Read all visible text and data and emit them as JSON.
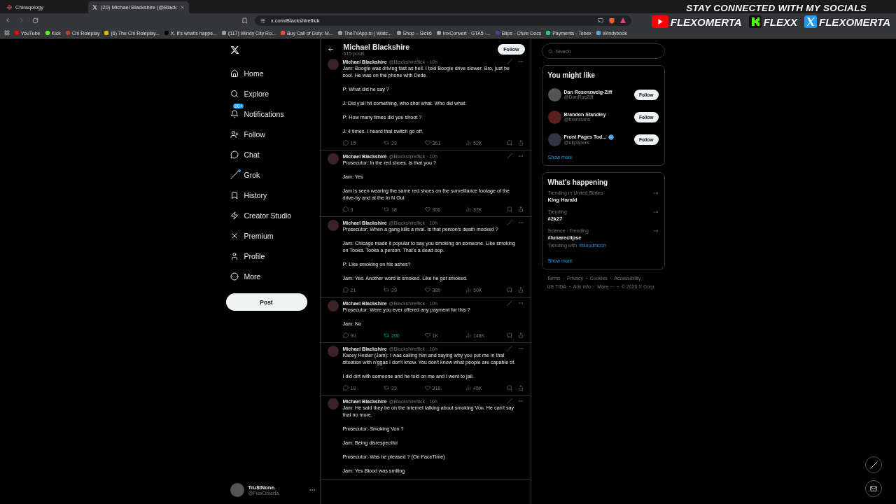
{
  "browser": {
    "tabs": [
      {
        "title": "Chiraqology",
        "selected": false
      },
      {
        "title": "(20) Michael Blackshire (@Black",
        "selected": true
      }
    ],
    "address": "x.com/Blackshireflick",
    "bookmarks": [
      {
        "label": "YouTube",
        "color": "#ff0000"
      },
      {
        "label": "Kick",
        "color": "#53fc18"
      },
      {
        "label": "Chi Roleplay",
        "color": "#c0392b"
      },
      {
        "label": "(6) The Chi Roleplay...",
        "color": "#e6b800"
      },
      {
        "label": "X. It's what's happe...",
        "color": "#000000"
      },
      {
        "label": "(117) Windy City Ro...",
        "color": "#9aa0a6"
      },
      {
        "label": "Buy Call of Duty: M...",
        "color": "#e74c3c"
      },
      {
        "label": "TheTVApp.to | Watc...",
        "color": "#9aa0a6"
      },
      {
        "label": "Shop – Sick6",
        "color": "#9aa0a6"
      },
      {
        "label": "InxConvert - GTA5 -...",
        "color": "#9aa0a6"
      },
      {
        "label": "Blips - Cfure Docs",
        "color": "#3b4a8c"
      },
      {
        "label": "Payments - Tebex",
        "color": "#2ecc71"
      },
      {
        "label": "Windybook",
        "color": "#5dade2"
      }
    ]
  },
  "overlay": {
    "heading": "STAY CONNECTED WITH MY SOCIALS",
    "socials": [
      {
        "kind": "youtube",
        "handle": "FLEXOMERTA"
      },
      {
        "kind": "kick",
        "handle": "FLEXX"
      },
      {
        "kind": "x",
        "handle": "FLEXOMERTA"
      }
    ]
  },
  "nav": {
    "items": [
      {
        "label": "Home",
        "dot": false
      },
      {
        "label": "Explore",
        "dot": false
      },
      {
        "label": "Notifications",
        "badge": "20+",
        "dot": false
      },
      {
        "label": "Follow",
        "dot": false
      },
      {
        "label": "Chat",
        "dot": false
      },
      {
        "label": "Grok",
        "dot": true
      },
      {
        "label": "History",
        "dot": false
      },
      {
        "label": "Creator Studio",
        "dot": false
      },
      {
        "label": "Premium",
        "dot": false
      },
      {
        "label": "Profile",
        "dot": false
      },
      {
        "label": "More",
        "dot": false
      }
    ],
    "post_button": "Post",
    "account": {
      "name": "Tru$tNone.",
      "handle": "@FlexOmerta"
    }
  },
  "profile_header": {
    "name": "Michael Blackshire",
    "posts": "615 posts",
    "follow": "Follow"
  },
  "tweets": [
    {
      "author": "Michael Blackshire",
      "handle": "@Blackshireflick · 10h",
      "paragraphs": [
        "Jam: Boogie was driving fast as hell. I told Boogie drive slower. Bro, just be cool. He was on the phone with Dede.",
        "P: What did he say ?",
        "J: Did y'all hit something, who shot what. Who did what.",
        "P: How many times did you shoot ?",
        "J: 4 times. I heard that switch go off."
      ],
      "replies": "15",
      "reposts": "23",
      "likes": "361",
      "views": "52K",
      "repost_highlighted": false
    },
    {
      "author": "Michael Blackshire",
      "handle": "@Blackshireflick · 10h",
      "paragraphs": [
        "Prosecutor: In the red shoes. Is that you ?",
        "Jam: Yes",
        "Jam is seen wearing the same red shoes on the surveillance footage of the drive-by and at the In N Out"
      ],
      "replies": "3",
      "reposts": "18",
      "likes": "306",
      "views": "37K",
      "repost_highlighted": false
    },
    {
      "author": "Michael Blackshire",
      "handle": "@Blackshireflick · 10h",
      "paragraphs": [
        "Prosecutor: When a gang kills a rival. Is that person's death mocked ?",
        "Jam: Chicago made it popular to say you smoking on someone. Like smoking on Tooka. Tooka a person. That's a dead oop.",
        "P: Like smoking on his ashes?",
        "Jam: Yes. Another word is smoked. Like he got smoked."
      ],
      "replies": "21",
      "reposts": "29",
      "likes": "389",
      "views": "50K",
      "repost_highlighted": false
    },
    {
      "author": "Michael Blackshire",
      "handle": "@Blackshireflick · 10h",
      "paragraphs": [
        "Prosecutor: Were you ever offered any payment for this ?",
        "Jam: No"
      ],
      "replies": "90",
      "reposts": "200",
      "likes": "1K",
      "views": "148K",
      "repost_highlighted": true
    },
    {
      "author": "Michael Blackshire",
      "handle": "@Blackshireflick · 10h",
      "paragraphs": [
        "Kacey Hester (Jam): I was calling him and saying why you put me in that situation with n'ggas I don't know. You don't know what people are capable of.",
        "I did dirt with someone and he told on me and I went to jail."
      ],
      "replies": "18",
      "reposts": "23",
      "likes": "318",
      "views": "45K",
      "repost_highlighted": false
    },
    {
      "author": "Michael Blackshire",
      "handle": "@Blackshireflick · 10h",
      "paragraphs": [
        "Jam: He said they be on the internet talking about smoking Von. He can't say that no more.",
        "Prosecutor: Smoking Von ?",
        "Jam: Being disrespectful",
        "Prosecutor: Was he pleased ? (On FaceTime)",
        "Jam: Yes Blood was smiling"
      ]
    }
  ],
  "sidebar": {
    "search_placeholder": "Search",
    "might_like": {
      "title": "You might like",
      "accounts": [
        {
          "name": "Dan Rosenzweig-Ziff",
          "handle": "@DanRosZiff",
          "verified": false,
          "follow": "Follow"
        },
        {
          "name": "Brandon Standley",
          "handle": "@branstans",
          "verified": false,
          "follow": "Follow"
        },
        {
          "name": "Front Pages Tod...",
          "handle": "@ukpapers",
          "verified": true,
          "follow": "Follow"
        }
      ],
      "show_more": "Show more"
    },
    "happening": {
      "title": "What's happening",
      "trends": [
        {
          "context": "Trending in United States",
          "name": "King Harald"
        },
        {
          "context": "Trending",
          "name": "#2k27"
        },
        {
          "context": "Science · Trending",
          "name": "#lunareclipse",
          "with_label": "Trending with",
          "with_tag": "#bloodmoon"
        }
      ],
      "show_more": "Show more"
    },
    "footer": [
      [
        "Terms",
        "Privacy",
        "Cookies",
        "Accessibility"
      ],
      [
        "US TIDA",
        "Ads info",
        "More ···",
        "© 2026 X Corp."
      ]
    ]
  }
}
